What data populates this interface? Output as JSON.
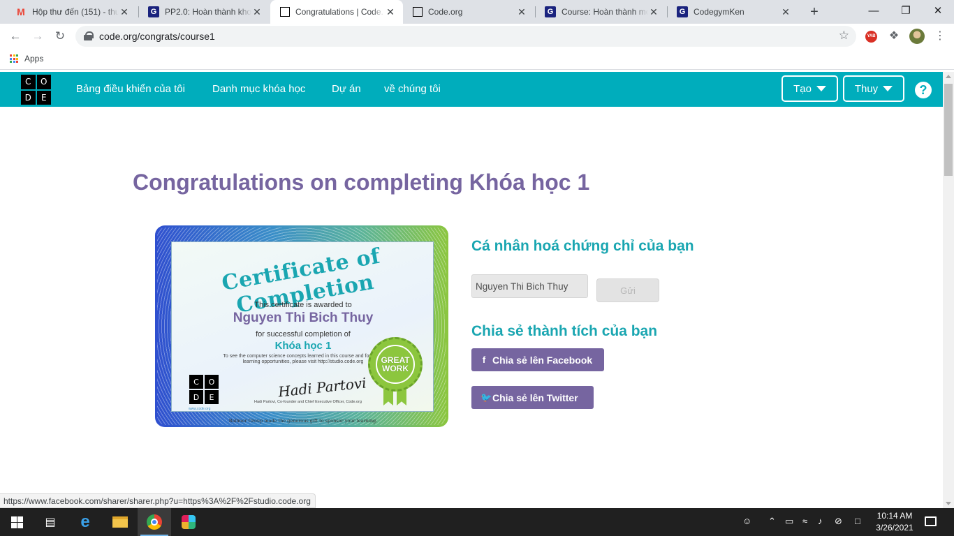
{
  "browser": {
    "tabs": [
      {
        "title": "Hộp thư đến (151) - thu",
        "icon": "gmail-icon"
      },
      {
        "title": "PP2.0: Hoàn thành khoá",
        "icon": "codegym-icon"
      },
      {
        "title": "Congratulations | Code.",
        "icon": "code-org-icon",
        "active": true
      },
      {
        "title": "Code.org",
        "icon": "code-org-icon"
      },
      {
        "title": "Course: Hoàn thành mc",
        "icon": "codegym-icon"
      },
      {
        "title": "CodegymKen",
        "icon": "codegym-icon"
      }
    ],
    "new_tab": "+",
    "close_glyph": "✕",
    "window_controls": {
      "minimize": "—",
      "maximize": "❐",
      "close": "✕"
    },
    "url": "code.org/congrats/course1",
    "extension_badge": "YAB",
    "bookmarks": {
      "apps_label": "Apps"
    }
  },
  "header": {
    "logo_letters": [
      "C",
      "O",
      "D",
      "E"
    ],
    "nav": [
      {
        "label": "Bảng điều khiển của tôi"
      },
      {
        "label": "Danh mục khóa học"
      },
      {
        "label": "Dự án"
      },
      {
        "label": "về chúng tôi"
      }
    ],
    "create_label": "Tạo",
    "user_label": "Thuy",
    "help_label": "?"
  },
  "main": {
    "title": "Congratulations on completing Khóa học 1",
    "certificate": {
      "heading": "Certificate of Completion",
      "awarded_to": "This certificate is awarded to",
      "name": "Nguyen Thi Bich Thuy",
      "for_completion": "for successful completion of",
      "course": "Khóa học 1",
      "note": "To see the computer science concepts learned in this course and for more learning opportunities, please visit http://studio.code.org",
      "logo_letters": [
        "C",
        "O",
        "D",
        "E"
      ],
      "site": "www.code.org",
      "signature": "Hadi Partovi",
      "signer": "Hadi Partovi, Co-founder and Chief Executive Officer, Code.org",
      "sponsor": "Ballmer Group made the generous gift to sponsor your learning.",
      "badge": "GREAT WORK"
    },
    "personalize": {
      "heading": "Cá nhân hoá chứng chỉ của bạn",
      "name_value": "Nguyen Thi Bich Thuy",
      "submit_label": "Gửi"
    },
    "share": {
      "heading": "Chia sẻ thành tích của bạn",
      "facebook_icon_glyph": "f",
      "facebook_label": "Chia sẻ lên Facebook",
      "twitter_icon_glyph": "🐦",
      "twitter_label": "Chia sẻ lên Twitter"
    }
  },
  "status_bar": {
    "link_preview": "https://www.facebook.com/sharer/sharer.php?u=https%3A%2F%2Fstudio.code.org"
  },
  "taskbar": {
    "time": "10:14 AM",
    "date": "3/26/2021"
  },
  "colors": {
    "header_bg": "#00adbc",
    "title_purple": "#7665a0",
    "heading_teal": "#1aa6b1",
    "share_button": "#7665a0"
  }
}
